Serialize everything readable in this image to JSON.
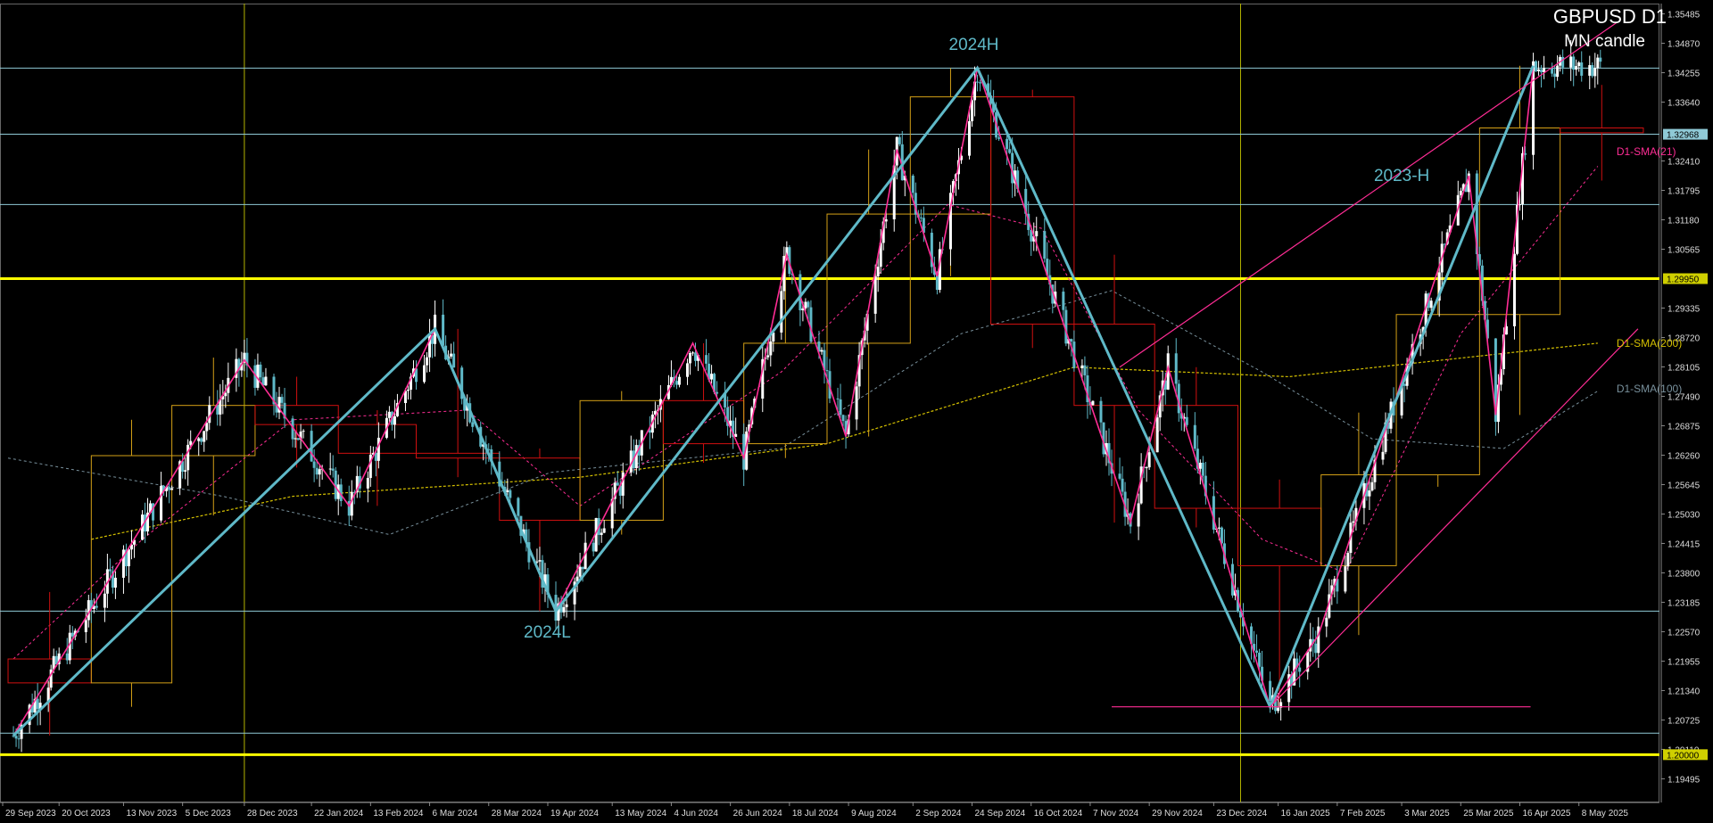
{
  "header": {
    "symbol": "GBPUSD D1",
    "subtitle": "MN candle"
  },
  "annotations": {
    "high_2024": "2024H",
    "low_2024": "2024L",
    "high_2023": "2023-H"
  },
  "sma_labels": {
    "sma21": "D1-SMA(21)",
    "sma200": "D1-SMA(200)",
    "sma100": "D1-SMA(100)"
  },
  "colors": {
    "background": "#000000",
    "bull_candle": "#ffffff",
    "bear_candle": "#5fb9c8",
    "grid_level": "#8fc9d6",
    "key_level": "#ffff00",
    "zigzag": "#5fb9c8",
    "sub_zigzag": "#ff2d95",
    "month_bull_box": "#d4a017",
    "month_bear_box": "#d01010",
    "sma21": "#ff2d95",
    "sma200": "#d4c000",
    "sma100": "#78909c",
    "channel": "#ff2d95",
    "vertical_marker": "#b3b300"
  },
  "chart_data": {
    "type": "candlestick",
    "instrument": "GBPUSD",
    "timeframe": "D1",
    "ylim": [
      1.19,
      1.357
    ],
    "y_ticks": [
      "1.35485",
      "1.34870",
      "1.34255",
      "1.33640",
      "1.32410",
      "1.31795",
      "1.31180",
      "1.30565",
      "1.29335",
      "1.28720",
      "1.28105",
      "1.27490",
      "1.26875",
      "1.26260",
      "1.25645",
      "1.25030",
      "1.24415",
      "1.23800",
      "1.23185",
      "1.22570",
      "1.21955",
      "1.21340",
      "1.20725",
      "1.20110",
      "1.19495"
    ],
    "price_badges": [
      "1.32968",
      "1.29950",
      "1.20000"
    ],
    "x_ticks": [
      "29 Sep 2023",
      "20 Oct 2023",
      "13 Nov 2023",
      "5 Dec 2023",
      "28 Dec 2023",
      "22 Jan 2024",
      "13 Feb 2024",
      "6 Mar 2024",
      "28 Mar 2024",
      "19 Apr 2024",
      "13 May 2024",
      "4 Jun 2024",
      "26 Jun 2024",
      "18 Jul 2024",
      "9 Aug 2024",
      "2 Sep 2024",
      "24 Sep 2024",
      "16 Oct 2024",
      "7 Nov 2024",
      "29 Nov 2024",
      "23 Dec 2024",
      "16 Jan 2025",
      "7 Feb 2025",
      "3 Mar 2025",
      "25 Mar 2025",
      "16 Apr 2025",
      "8 May 2025"
    ],
    "horizontal_levels": [
      {
        "price": 1.3435,
        "style": "cyan"
      },
      {
        "price": 1.3297,
        "style": "cyan"
      },
      {
        "price": 1.315,
        "style": "cyan"
      },
      {
        "price": 1.2995,
        "style": "yellow"
      },
      {
        "price": 1.23,
        "style": "cyan"
      },
      {
        "price": 1.2045,
        "style": "cyan"
      },
      {
        "price": 1.2,
        "style": "yellow"
      }
    ],
    "vertical_markers": [
      "28 Dec 2023",
      "2 Jan 2025"
    ],
    "zigzag": [
      {
        "date": "2023-10-03",
        "price": 1.204
      },
      {
        "date": "2024-03-08",
        "price": 1.289
      },
      {
        "date": "2024-04-22",
        "price": 1.23
      },
      {
        "date": "2024-09-26",
        "price": 1.3435
      },
      {
        "date": "2025-01-13",
        "price": 1.21
      },
      {
        "date": "2025-04-21",
        "price": 1.344
      }
    ],
    "sub_zigzag": [
      {
        "date": "2023-10-03",
        "price": 1.204
      },
      {
        "date": "2023-12-28",
        "price": 1.2825
      },
      {
        "date": "2024-02-05",
        "price": 1.252
      },
      {
        "date": "2024-03-08",
        "price": 1.289
      },
      {
        "date": "2024-04-22",
        "price": 1.23
      },
      {
        "date": "2024-06-12",
        "price": 1.286
      },
      {
        "date": "2024-07-01",
        "price": 1.262
      },
      {
        "date": "2024-07-17",
        "price": 1.3045
      },
      {
        "date": "2024-08-08",
        "price": 1.2665
      },
      {
        "date": "2024-08-27",
        "price": 1.3265
      },
      {
        "date": "2024-09-11",
        "price": 1.3
      },
      {
        "date": "2024-09-26",
        "price": 1.3435
      },
      {
        "date": "2024-11-22",
        "price": 1.2485
      },
      {
        "date": "2024-12-06",
        "price": 1.281
      },
      {
        "date": "2025-01-13",
        "price": 1.21
      },
      {
        "date": "2025-01-31",
        "price": 1.225
      },
      {
        "date": "2025-03-28",
        "price": 1.321
      },
      {
        "date": "2025-04-07",
        "price": 1.271
      },
      {
        "date": "2025-04-21",
        "price": 1.344
      }
    ],
    "monthly_candles": [
      {
        "month": "2023-10",
        "open": 1.22,
        "high": 1.234,
        "low": 1.204,
        "close": 1.215
      },
      {
        "month": "2023-11",
        "open": 1.215,
        "high": 1.27,
        "low": 1.21,
        "close": 1.2625
      },
      {
        "month": "2023-12",
        "open": 1.2625,
        "high": 1.283,
        "low": 1.25,
        "close": 1.273
      },
      {
        "month": "2024-01",
        "open": 1.273,
        "high": 1.279,
        "low": 1.26,
        "close": 1.269
      },
      {
        "month": "2024-02",
        "open": 1.269,
        "high": 1.272,
        "low": 1.252,
        "close": 1.263
      },
      {
        "month": "2024-03",
        "open": 1.263,
        "high": 1.289,
        "low": 1.258,
        "close": 1.262
      },
      {
        "month": "2024-04",
        "open": 1.262,
        "high": 1.264,
        "low": 1.23,
        "close": 1.249
      },
      {
        "month": "2024-05",
        "open": 1.249,
        "high": 1.276,
        "low": 1.246,
        "close": 1.274
      },
      {
        "month": "2024-06",
        "open": 1.274,
        "high": 1.286,
        "low": 1.261,
        "close": 1.265
      },
      {
        "month": "2024-07",
        "open": 1.265,
        "high": 1.3045,
        "low": 1.262,
        "close": 1.286
      },
      {
        "month": "2024-08",
        "open": 1.286,
        "high": 1.3265,
        "low": 1.2665,
        "close": 1.313
      },
      {
        "month": "2024-09",
        "open": 1.313,
        "high": 1.3435,
        "low": 1.3,
        "close": 1.3375
      },
      {
        "month": "2024-10",
        "open": 1.3375,
        "high": 1.339,
        "low": 1.285,
        "close": 1.29
      },
      {
        "month": "2024-11",
        "open": 1.29,
        "high": 1.3045,
        "low": 1.2485,
        "close": 1.273
      },
      {
        "month": "2024-12",
        "open": 1.273,
        "high": 1.281,
        "low": 1.2475,
        "close": 1.2515
      },
      {
        "month": "2025-01",
        "open": 1.2515,
        "high": 1.2575,
        "low": 1.21,
        "close": 1.2395
      },
      {
        "month": "2025-02",
        "open": 1.2395,
        "high": 1.2715,
        "low": 1.225,
        "close": 1.2585
      },
      {
        "month": "2025-03",
        "open": 1.2585,
        "high": 1.3015,
        "low": 1.256,
        "close": 1.292
      },
      {
        "month": "2025-04",
        "open": 1.292,
        "high": 1.344,
        "low": 1.271,
        "close": 1.331
      },
      {
        "month": "2025-05",
        "open": 1.331,
        "high": 1.34,
        "low": 1.32,
        "close": 1.33
      }
    ],
    "sma21": [
      {
        "date": "2023-10-03",
        "price": 1.22
      },
      {
        "date": "2023-11-20",
        "price": 1.245
      },
      {
        "date": "2024-01-15",
        "price": 1.27
      },
      {
        "date": "2024-03-20",
        "price": 1.272
      },
      {
        "date": "2024-05-01",
        "price": 1.252
      },
      {
        "date": "2024-07-15",
        "price": 1.28
      },
      {
        "date": "2024-09-15",
        "price": 1.315
      },
      {
        "date": "2024-10-20",
        "price": 1.31
      },
      {
        "date": "2024-11-25",
        "price": 1.272
      },
      {
        "date": "2025-01-10",
        "price": 1.245
      },
      {
        "date": "2025-02-10",
        "price": 1.238
      },
      {
        "date": "2025-03-25",
        "price": 1.288
      },
      {
        "date": "2025-05-15",
        "price": 1.323
      }
    ],
    "sma200": [
      {
        "date": "2023-11-01",
        "price": 1.245
      },
      {
        "date": "2024-01-15",
        "price": 1.254
      },
      {
        "date": "2024-05-01",
        "price": 1.258
      },
      {
        "date": "2024-08-01",
        "price": 1.265
      },
      {
        "date": "2024-11-01",
        "price": 1.281
      },
      {
        "date": "2025-01-20",
        "price": 1.279
      },
      {
        "date": "2025-05-15",
        "price": 1.286
      }
    ],
    "sma100": [
      {
        "date": "2023-10-01",
        "price": 1.262
      },
      {
        "date": "2023-12-20",
        "price": 1.254
      },
      {
        "date": "2024-02-20",
        "price": 1.246
      },
      {
        "date": "2024-04-20",
        "price": 1.259
      },
      {
        "date": "2024-07-15",
        "price": 1.264
      },
      {
        "date": "2024-09-20",
        "price": 1.288
      },
      {
        "date": "2024-11-15",
        "price": 1.297
      },
      {
        "date": "2025-01-10",
        "price": 1.28
      },
      {
        "date": "2025-02-20",
        "price": 1.266
      },
      {
        "date": "2025-04-10",
        "price": 1.264
      },
      {
        "date": "2025-05-15",
        "price": 1.276
      }
    ],
    "channel_upper": [
      {
        "date": "2024-11-18",
        "price": 1.281
      },
      {
        "date": "2025-05-22",
        "price": 1.353
      }
    ],
    "channel_lower": [
      {
        "date": "2025-01-13",
        "price": 1.21
      },
      {
        "date": "2025-05-30",
        "price": 1.289
      }
    ],
    "low_marker": {
      "price": 1.21,
      "from": "2024-11-15",
      "to": "2025-04-20"
    }
  }
}
